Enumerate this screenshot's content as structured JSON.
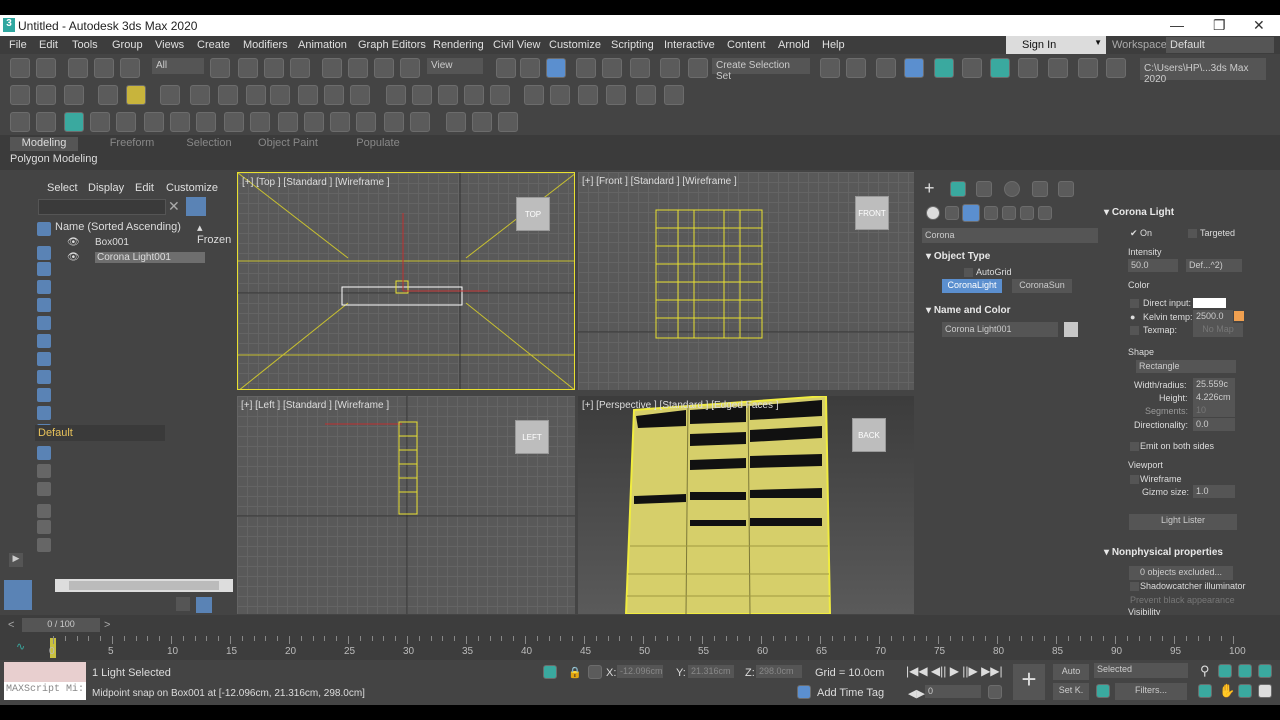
{
  "window": {
    "title": "Untitled - Autodesk 3ds Max 2020",
    "minimize": "—",
    "maximize": "❐",
    "close": "✕"
  },
  "menu": [
    "File",
    "Edit",
    "Tools",
    "Group",
    "Views",
    "Create",
    "Modifiers",
    "Animation",
    "Graph Editors",
    "Rendering",
    "Civil View",
    "Customize",
    "Scripting",
    "Interactive",
    "Content",
    "Arnold",
    "Help"
  ],
  "signin": "Sign In",
  "workspaces": {
    "label": "Workspaces:",
    "value": "Default"
  },
  "toolbar": {
    "filter": "All",
    "refcoord": "View",
    "selset": "Create Selection Set",
    "path": "C:\\Users\\HP\\...3ds Max 2020"
  },
  "ribbon": {
    "tabs": [
      "Modeling",
      "Freeform",
      "Selection",
      "Object Paint",
      "Populate"
    ],
    "panel": "Polygon Modeling"
  },
  "explorer": {
    "menu": [
      "Select",
      "Display",
      "Edit",
      "Customize"
    ],
    "column": "Name (Sorted Ascending)",
    "frozen": "▴ Frozen",
    "rows": [
      "Box001",
      "Corona Light001"
    ],
    "layer": "Default"
  },
  "viewports": {
    "top": "[+] [Top ] [Standard ] [Wireframe ]",
    "front": "[+] [Front ] [Standard ] [Wireframe ]",
    "left": "[+] [Left ] [Standard ] [Wireframe ]",
    "persp": "[+] [Perspective ] [Standard ] [Edged Faces ]",
    "cubes": {
      "top": "TOP",
      "front": "FRONT",
      "left": "LEFT",
      "back": "BACK"
    }
  },
  "command": {
    "category": "Corona",
    "object_type": {
      "title": "Object Type",
      "autogrid": "AutoGrid",
      "buttons": [
        "CoronaLight",
        "CoronaSun"
      ]
    },
    "name_color": {
      "title": "Name and Color",
      "name": "Corona Light001"
    }
  },
  "corona_light": {
    "title": "Corona Light",
    "on": "On",
    "targeted": "Targeted",
    "intensity_label": "Intensity",
    "intensity": "50.0",
    "units": "Def...^2)",
    "color_label": "Color",
    "direct": "Direct input:",
    "kelvin": "Kelvin temp:",
    "kelvin_val": "2500.0",
    "texmap": "Texmap:",
    "nomap": "No Map",
    "shape_label": "Shape",
    "shape": "Rectangle",
    "width_l": "Width/radius:",
    "width": "25.559c",
    "height_l": "Height:",
    "height": "4.226cm",
    "seg_l": "Segments:",
    "seg": "10",
    "dir_l": "Directionality:",
    "dir": "0.0",
    "emit": "Emit on both sides",
    "viewport_label": "Viewport",
    "wireframe": "Wireframe",
    "gizmo_l": "Gizmo size:",
    "gizmo": "1.0",
    "lister": "Light Lister",
    "nonphys": "Nonphysical properties",
    "excluded": "0 objects excluded...",
    "shadowcatcher": "Shadowcatcher illuminator",
    "prevent": "Prevent black appearance",
    "visibility": "Visibility"
  },
  "time": {
    "frame": "0 / 100",
    "ticks": [
      "0",
      "5",
      "10",
      "15",
      "20",
      "25",
      "30",
      "35",
      "40",
      "45",
      "50",
      "55",
      "60",
      "65",
      "70",
      "75",
      "80",
      "85",
      "90",
      "95",
      "100"
    ]
  },
  "status": {
    "selected": "1 Light Selected",
    "prompt": "Midpoint snap on Box001 at [-12.096cm, 21.316cm, 298.0cm]",
    "maxscript": "MAXScript Mi:",
    "x": "-12.096cm",
    "y": "21.316cm",
    "z": "298.0cm",
    "grid": "Grid = 10.0cm",
    "timetag": "Add Time Tag",
    "auto": "Auto",
    "setk": "Set K.",
    "selected_dd": "Selected",
    "filters": "Filters...",
    "frame": "0"
  },
  "colors": {
    "accent": "#5b8fcf",
    "wire": "#e8e030",
    "bg": "#444444"
  }
}
